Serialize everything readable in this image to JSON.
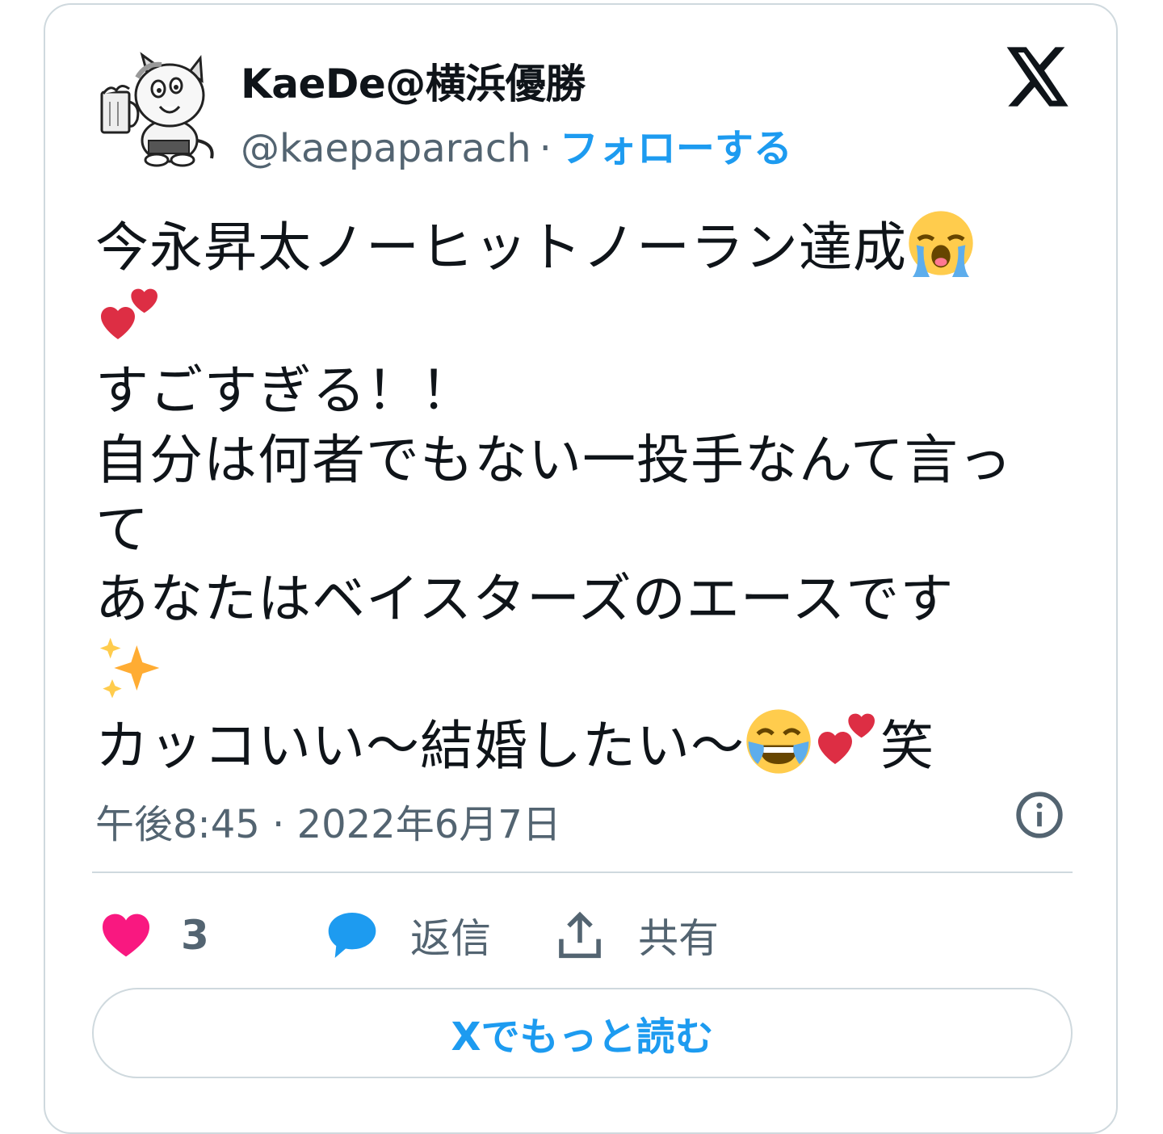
{
  "author": {
    "display_name": "KaeDe@横浜優勝",
    "handle": "@kaepaparach",
    "separator": "·",
    "follow_label": "フォローする"
  },
  "tweet": {
    "line1": "今永昇太ノーヒットノーラン達成",
    "line2": "すごすぎる！！",
    "line3a": "自分は何者でもない一投手なんて言っ",
    "line3b": "て",
    "line4": "あなたはベイスターズのエースです",
    "line5": "カッコいい〜結婚したい〜",
    "line5_end": "笑",
    "emojis": [
      "loudly-crying-face",
      "two-hearts",
      "sparkles",
      "face-with-tears-of-joy",
      "two-hearts"
    ]
  },
  "meta": {
    "timestamp": "午後8:45 · 2022年6月7日"
  },
  "actions": {
    "like_count": "3",
    "reply_label": "返信",
    "share_label": "共有"
  },
  "read_more_label": "Xでもっと読む",
  "colors": {
    "accent": "#1d9bf0",
    "like": "#f91880",
    "secondary_text": "#536471",
    "border": "#cfd9de"
  }
}
